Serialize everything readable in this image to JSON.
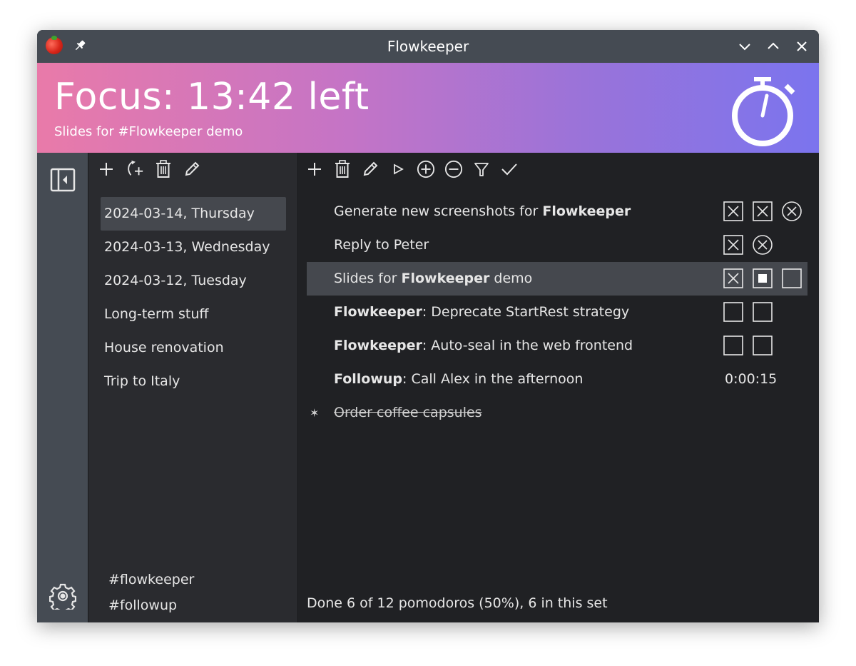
{
  "window": {
    "title": "Flowkeeper"
  },
  "banner": {
    "focus_text": "Focus: 13:42 left",
    "subtitle": "Slides for #Flowkeeper demo",
    "gradient": [
      "#e97aa9",
      "#7b74ee"
    ]
  },
  "backlogs": {
    "items": [
      {
        "label": "2024-03-14, Thursday",
        "selected": true
      },
      {
        "label": "2024-03-13, Wednesday",
        "selected": false
      },
      {
        "label": "2024-03-12, Tuesday",
        "selected": false
      },
      {
        "label": "Long-term stuff",
        "selected": false
      },
      {
        "label": "House renovation",
        "selected": false
      },
      {
        "label": "Trip to Italy",
        "selected": false
      }
    ],
    "tags": [
      "#flowkeeper",
      "#followup"
    ]
  },
  "workitems": {
    "rows": [
      {
        "pre": "Generate new screenshots for ",
        "bold": "Flowkeeper",
        "post": "",
        "pomodoros": [
          "done",
          "done",
          "voided"
        ]
      },
      {
        "pre": "Reply to Peter",
        "bold": "",
        "post": "",
        "pomodoros": [
          "done",
          "voided"
        ]
      },
      {
        "pre": "Slides for ",
        "bold": "Flowkeeper",
        "post": " demo",
        "pomodoros": [
          "done",
          "running",
          "new"
        ]
      },
      {
        "pre": "",
        "bold": "Flowkeeper",
        "post": ": Deprecate StartRest strategy",
        "pomodoros": [
          "new",
          "new"
        ]
      },
      {
        "pre": "",
        "bold": "Flowkeeper",
        "post": ": Auto-seal in the web frontend",
        "pomodoros": [
          "new",
          "new"
        ]
      },
      {
        "pre": "",
        "bold": "Followup",
        "post": ": Call Alex in the afternoon",
        "elapsed": "0:00:15"
      },
      {
        "pre": "Order coffee capsules",
        "bold": "",
        "post": "",
        "sealed": true,
        "mark": "✶"
      }
    ],
    "status": "Done 6 of 12 pomodoros (50%), 6 in this set"
  },
  "icons": {
    "titlebar": [
      "app-tomato-icon",
      "pin-icon",
      "minimize-icon",
      "maximize-icon",
      "close-icon"
    ],
    "backlog_toolbar": [
      "add-icon",
      "add-from-incomplete-icon",
      "delete-icon",
      "rename-icon"
    ],
    "workitem_toolbar": [
      "add-icon",
      "delete-icon",
      "rename-icon",
      "start-icon",
      "add-pomodoro-icon",
      "remove-pomodoro-icon",
      "filter-icon",
      "complete-icon"
    ]
  }
}
